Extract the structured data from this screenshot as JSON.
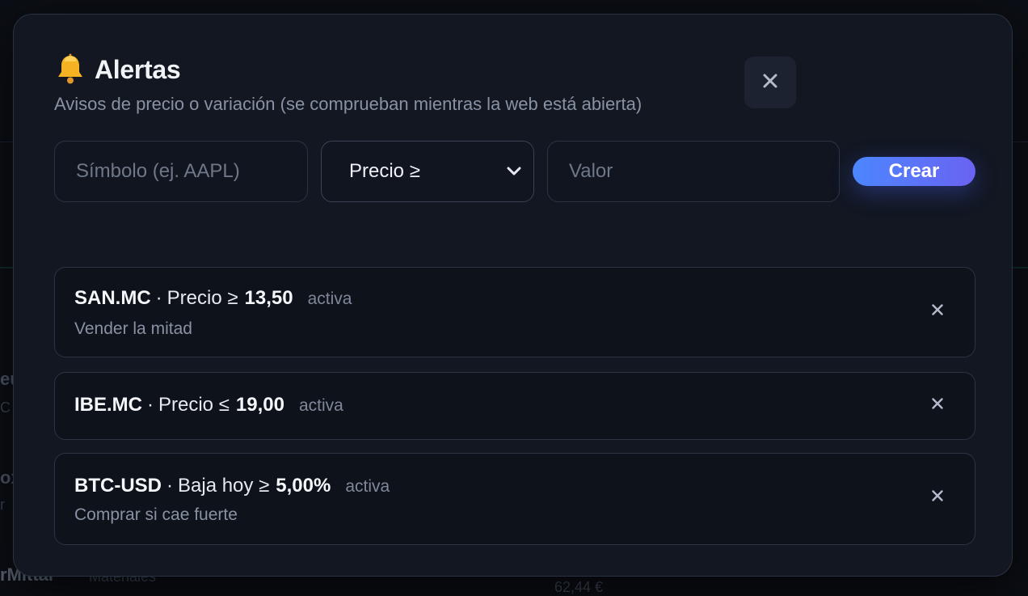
{
  "background": {
    "fragments": [
      "eus",
      "C",
      "ox",
      "r",
      "rMittal",
      "Materiales",
      "62,44 €"
    ]
  },
  "modal": {
    "title": "Alertas",
    "subtitle": "Avisos de precio o variación (se comprueban mientras la web está abierta)",
    "icon": "bell-icon",
    "close_icon": "close-icon"
  },
  "form": {
    "symbol_placeholder": "Símbolo (ej. AAPL)",
    "condition_selected": "Precio ≥",
    "value_placeholder": "Valor",
    "create_label": "Crear"
  },
  "alerts": [
    {
      "symbol": "SAN.MC",
      "sep": "·",
      "condition": "Precio ≥",
      "threshold": "13,50",
      "status": "activa",
      "note": "Vender la mitad"
    },
    {
      "symbol": "IBE.MC",
      "sep": "·",
      "condition": "Precio ≤",
      "threshold": "19,00",
      "status": "activa",
      "note": ""
    },
    {
      "symbol": "BTC-USD",
      "sep": "·",
      "condition": "Baja hoy ≥",
      "threshold": "5,00%",
      "status": "activa",
      "note": "Comprar si cae fuerte"
    }
  ],
  "colors": {
    "accent_start": "#4c86ff",
    "accent_end": "#6a63f2",
    "modal_bg": "#121722",
    "bell": "#f5b324"
  }
}
